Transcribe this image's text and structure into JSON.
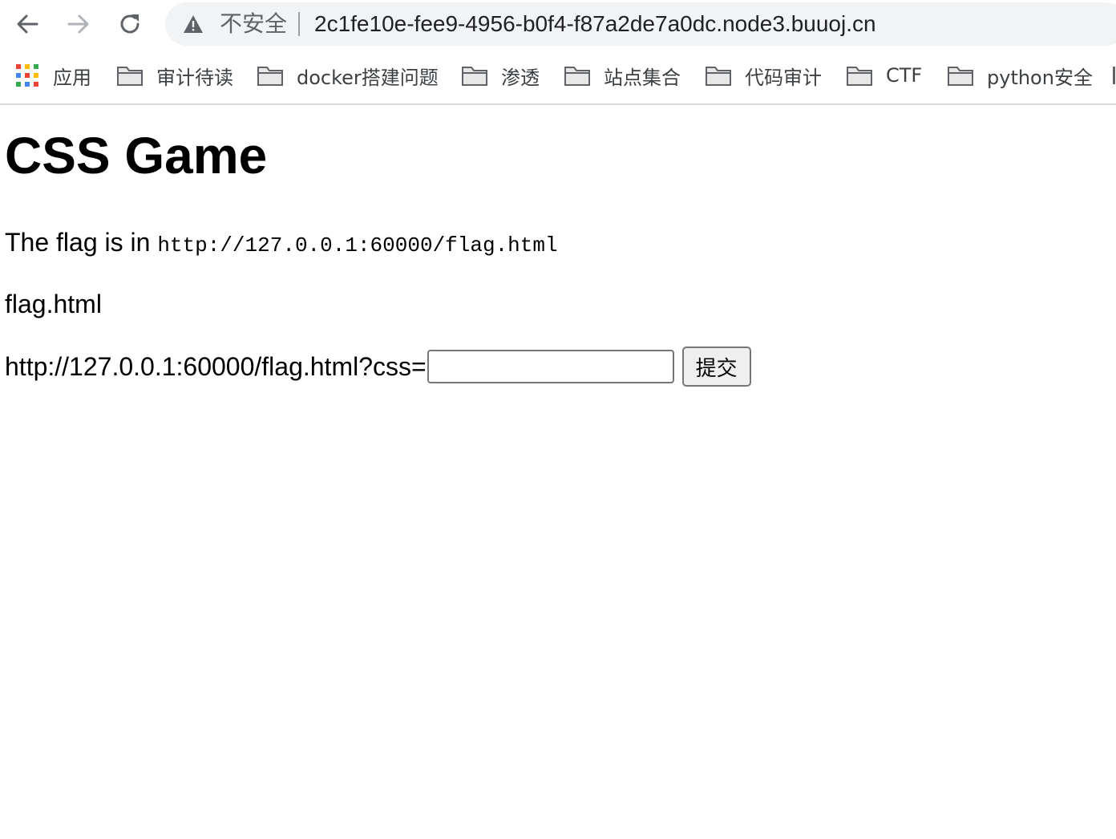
{
  "browser": {
    "insecure_label": "不安全",
    "url": "2c1fe10e-fee9-4956-b0f4-f87a2de7a0dc.node3.buuoj.cn",
    "apps_label": "应用",
    "bookmarks": [
      {
        "label": "审计待读"
      },
      {
        "label": "docker搭建问题"
      },
      {
        "label": "渗透"
      },
      {
        "label": "站点集合"
      },
      {
        "label": "代码审计"
      },
      {
        "label": "CTF"
      },
      {
        "label": "python安全"
      }
    ],
    "apps_colors": [
      "#ea4335",
      "#fbbc04",
      "#34a853",
      "#4285f4",
      "#ea4335",
      "#fbbc04",
      "#34a853",
      "#4285f4",
      "#ea4335"
    ]
  },
  "page": {
    "title": "CSS Game",
    "flag_text": "The flag is in ",
    "flag_url": "http://127.0.0.1:60000/flag.html",
    "file_name": "flag.html",
    "form_prefix": "http://127.0.0.1:60000/flag.html?css=",
    "input_value": "",
    "submit_label": "提交"
  }
}
